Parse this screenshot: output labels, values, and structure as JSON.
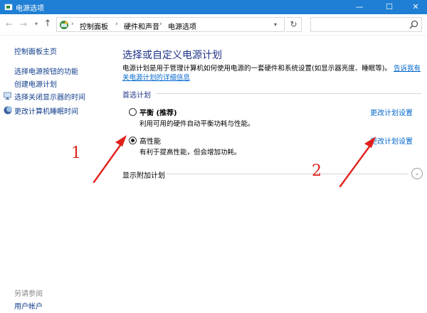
{
  "window": {
    "title": "电源选项",
    "controls": {
      "minimize": "—",
      "maximize": "☐",
      "close": "✕"
    }
  },
  "addressbar": {
    "crumbs": [
      "控制面板",
      "硬件和声音",
      "电源选项"
    ],
    "separator": "›",
    "search_placeholder": ""
  },
  "sidebar": {
    "links": [
      "控制面板主页",
      "选择电源按钮的功能",
      "创建电源计划",
      "选择关闭显示器的时间",
      "更改计算机睡眠时间"
    ],
    "see_also_label": "另请参阅",
    "see_also_links": [
      "用户帐户"
    ]
  },
  "main": {
    "title": "选择或自定义电源计划",
    "description": "电源计划是用于管理计算机如何使用电源的一套硬件和系统设置(如显示器亮度、睡眠等)。",
    "description_link": "告诉我有关电源计划的详细信息",
    "section_label": "首选计划",
    "plans": [
      {
        "name": "平衡 (推荐)",
        "description": "利用可用的硬件自动平衡功耗与性能。",
        "selected": false,
        "change_link": "更改计划设置"
      },
      {
        "name": "高性能",
        "description": "有利于提高性能，但会增加功耗。",
        "selected": true,
        "change_link": "更改计划设置"
      }
    ],
    "extra_plans_label": "显示附加计划"
  },
  "annotations": {
    "label_1": "1",
    "label_2": "2",
    "color": "#e0211b"
  },
  "colors": {
    "titlebar": "#1f7fd4",
    "link": "#0066cc",
    "heading": "#1e3287"
  }
}
